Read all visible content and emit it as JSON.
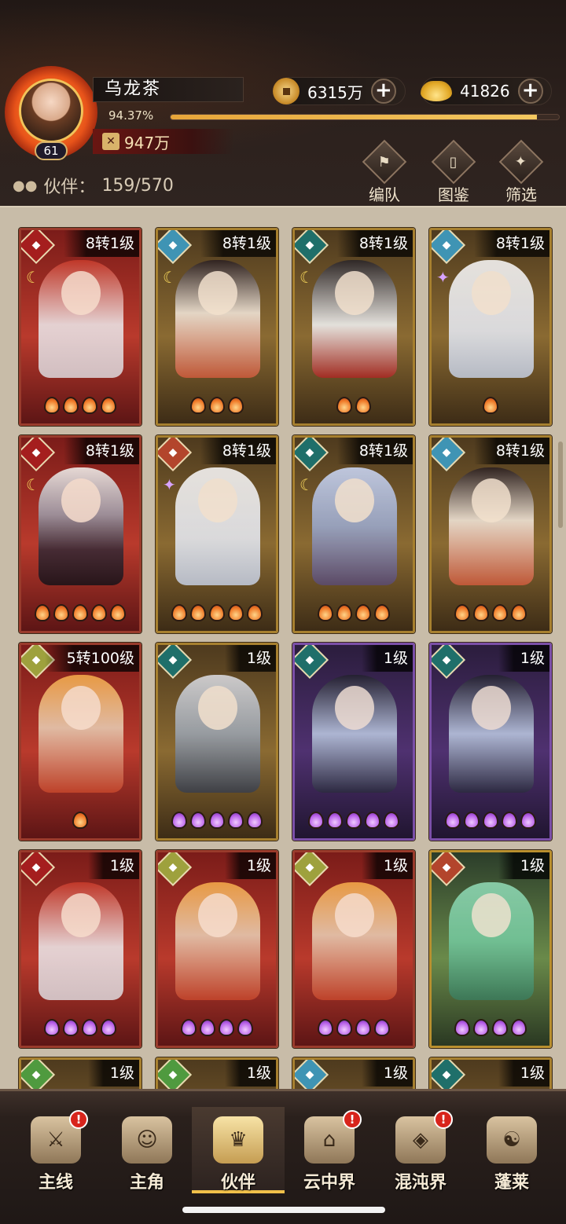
{
  "player": {
    "name": "乌龙茶",
    "level": "61",
    "exp_text": "94.37%",
    "exp_fraction": 0.9437,
    "power": "947万"
  },
  "currency": {
    "coins": "6315万",
    "ingots": "41826"
  },
  "partners": {
    "label": "伙伴：",
    "count": "159/570"
  },
  "actions": [
    {
      "label": "编队",
      "icon": "flag-icon"
    },
    {
      "label": "图鉴",
      "icon": "scroll-icon"
    },
    {
      "label": "筛选",
      "icon": "filter-icon"
    }
  ],
  "cards": [
    {
      "rank": "8转1级",
      "frame": "red",
      "faction": "f-red",
      "portrait": "p-red",
      "mark": "moon",
      "stars": 4,
      "star_color": "orange"
    },
    {
      "rank": "8转1级",
      "frame": "gold",
      "faction": "f-blue",
      "portrait": "p-girl",
      "mark": "moon",
      "stars": 3,
      "star_color": "orange"
    },
    {
      "rank": "8转1级",
      "frame": "gold",
      "faction": "f-teal",
      "portrait": "p-black",
      "mark": "moon",
      "stars": 2,
      "star_color": "orange"
    },
    {
      "rank": "8转1级",
      "frame": "gold",
      "faction": "f-blue",
      "portrait": "p-white",
      "mark": "star",
      "stars": 1,
      "star_color": "orange"
    },
    {
      "rank": "8转1级",
      "frame": "red",
      "faction": "f-red",
      "portrait": "p-dark",
      "mark": "moon",
      "stars": 5,
      "star_color": "orange"
    },
    {
      "rank": "8转1级",
      "frame": "gold",
      "faction": "f-orange",
      "portrait": "p-white",
      "mark": "star",
      "stars": 5,
      "star_color": "orange"
    },
    {
      "rank": "8转1级",
      "frame": "gold",
      "faction": "f-teal",
      "portrait": "p-blue",
      "mark": "moon",
      "stars": 4,
      "star_color": "orange"
    },
    {
      "rank": "8转1级",
      "frame": "gold",
      "faction": "f-blue",
      "portrait": "p-girl",
      "mark": "",
      "stars": 4,
      "star_color": "orange"
    },
    {
      "rank": "5转100级",
      "frame": "red",
      "faction": "f-gold",
      "portrait": "p-monk",
      "mark": "",
      "stars": 1,
      "star_color": "orange"
    },
    {
      "rank": "1级",
      "frame": "gold",
      "faction": "f-teal",
      "portrait": "p-grey",
      "mark": "",
      "stars": 5,
      "star_color": "purple"
    },
    {
      "rank": "1级",
      "frame": "purple",
      "faction": "f-teal",
      "portrait": "p-purple",
      "mark": "",
      "stars": 5,
      "star_color": "purple"
    },
    {
      "rank": "1级",
      "frame": "purple",
      "faction": "f-teal",
      "portrait": "p-purple",
      "mark": "",
      "stars": 5,
      "star_color": "purple"
    },
    {
      "rank": "1级",
      "frame": "red",
      "faction": "f-red",
      "portrait": "p-red",
      "mark": "",
      "stars": 4,
      "star_color": "purple"
    },
    {
      "rank": "1级",
      "frame": "red",
      "faction": "f-gold",
      "portrait": "p-monk",
      "mark": "",
      "stars": 4,
      "star_color": "purple"
    },
    {
      "rank": "1级",
      "frame": "red",
      "faction": "f-gold",
      "portrait": "p-monk",
      "mark": "",
      "stars": 4,
      "star_color": "purple"
    },
    {
      "rank": "1级",
      "frame": "green",
      "faction": "f-orange",
      "portrait": "p-green",
      "mark": "",
      "stars": 4,
      "star_color": "purple"
    },
    {
      "rank": "1级",
      "frame": "gold",
      "faction": "f-green",
      "portrait": "p-dark",
      "mark": "",
      "stars": 0,
      "star_color": "purple"
    },
    {
      "rank": "1级",
      "frame": "gold",
      "faction": "f-green",
      "portrait": "p-dark",
      "mark": "",
      "stars": 0,
      "star_color": "purple"
    },
    {
      "rank": "1级",
      "frame": "gold",
      "faction": "f-blue",
      "portrait": "p-grey",
      "mark": "",
      "stars": 0,
      "star_color": "purple"
    },
    {
      "rank": "1级",
      "frame": "gold",
      "faction": "f-teal",
      "portrait": "p-dark",
      "mark": "",
      "stars": 0,
      "star_color": "purple"
    }
  ],
  "nav": [
    {
      "label": "主线",
      "icon": "crossed-swords-icon",
      "badge": "!",
      "active": false
    },
    {
      "label": "主角",
      "icon": "hero-portrait-icon",
      "badge": "",
      "active": false
    },
    {
      "label": "伙伴",
      "icon": "crown-helmet-icon",
      "badge": "",
      "active": true
    },
    {
      "label": "云中界",
      "icon": "pagoda-icon",
      "badge": "!",
      "active": false
    },
    {
      "label": "混沌界",
      "icon": "mask-icon",
      "badge": "!",
      "active": false
    },
    {
      "label": "蓬莱",
      "icon": "sage-icon",
      "badge": "",
      "active": false
    }
  ],
  "colors": {
    "exp_fill": "#f3c860",
    "active_tab": "#f0c04a",
    "badge": "#d8241c"
  }
}
